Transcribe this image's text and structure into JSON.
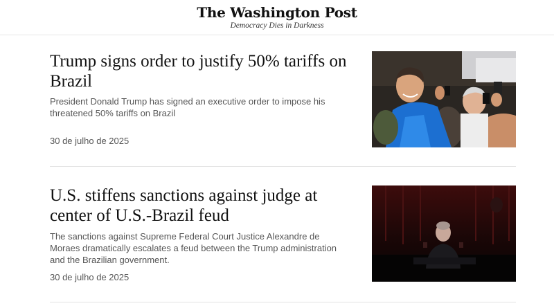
{
  "masthead": {
    "logo": "The Washington Post",
    "tagline": "Democracy Dies in Darkness"
  },
  "articles": [
    {
      "headline": "Trump signs order to justify 50% tariffs on Brazil",
      "blurb": "President Donald Trump has signed an executive order to impose his threatened 50% tariffs on Brazil",
      "date": "30 de julho de 2025"
    },
    {
      "headline": "U.S. stiffens sanctions against judge at center of U.S.-Brazil feud",
      "blurb": "The sanctions against Supreme Federal Court Justice Alexandre de Moraes dramatically escalates a feud between the Trump administration and the Brazilian government.",
      "date": "30 de julho de 2025"
    }
  ]
}
